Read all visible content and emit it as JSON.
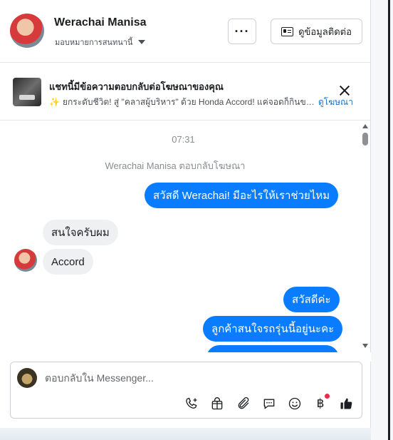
{
  "header": {
    "contact_name": "Werachai Manisa",
    "assign_label": "มอบหมายการสนทนานี้",
    "more_label": "···",
    "contact_info_label": "ดูข้อมูลติดต่อ"
  },
  "ad_banner": {
    "title": "แชทนี้มีข้อความตอบกลับต่อโฆษณาของคุณ",
    "snippet": "ยกระดับชีวิต! สู่ \"คลาสผู้บริหาร\" ด้วย Honda Accord! แค่จอดก็กินขาด!...",
    "link_label": "ดูโฆษณา"
  },
  "chat": {
    "time": "07:31",
    "reply_note": "Werachai Manisa ตอบกลับโฆษณา",
    "messages": [
      {
        "direction": "outgoing",
        "text": "สวัสดี Werachai! มีอะไรให้เราช่วยไหม"
      },
      {
        "direction": "incoming",
        "text": "สนใจครับผม"
      },
      {
        "direction": "incoming",
        "text": "Accord"
      },
      {
        "direction": "outgoing",
        "text": "สวัสดีค่ะ"
      },
      {
        "direction": "outgoing",
        "text": "ลูกค้าสนใจรถรุ่นนี้อยู่นะคะ"
      },
      {
        "direction": "outgoing",
        "text": ""
      }
    ]
  },
  "composer": {
    "placeholder": "ตอบกลับใน Messenger...",
    "value": "",
    "baht_symbol": "฿",
    "tools": [
      "call-add-icon",
      "bag-icon",
      "paperclip-icon",
      "chat-bubble-icon",
      "emoji-icon",
      "baht-icon",
      "thumbs-up-icon"
    ]
  },
  "colors": {
    "outgoing_bubble": "#0a7cff",
    "incoming_bubble": "#eef0f2",
    "link": "#1a73c8",
    "notification_dot": "#f02849"
  }
}
